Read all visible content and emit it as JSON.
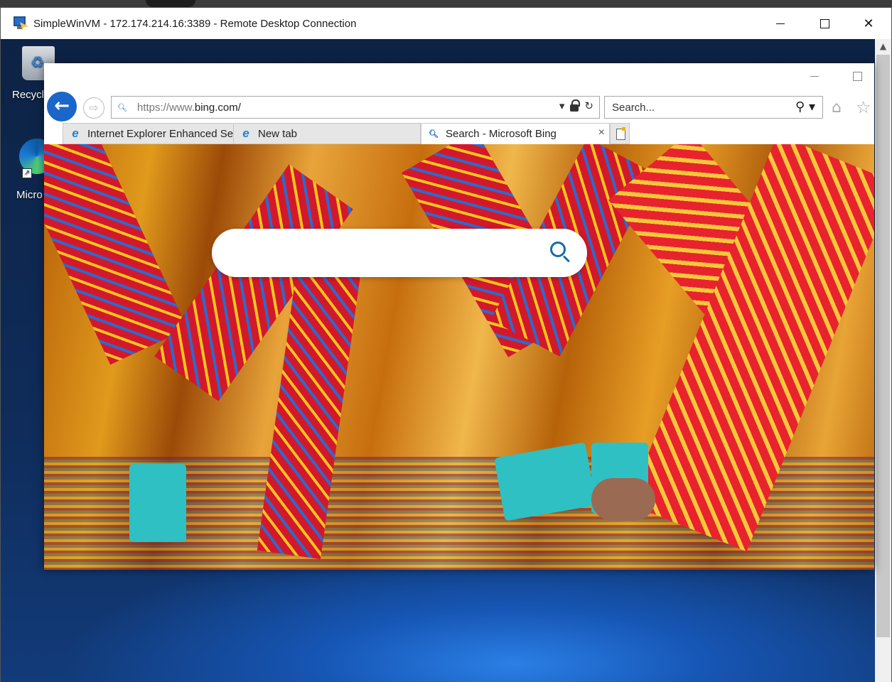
{
  "rdp": {
    "title": "SimpleWinVM - 172.174.214.16:3389 - Remote Desktop Connection",
    "min_glyph": "—",
    "max_glyph": "☐",
    "close_glyph": "✕"
  },
  "desktop": {
    "icons": [
      {
        "label": "Recycl",
        "icon": "recycle-bin-icon"
      },
      {
        "label": "Micro Edg",
        "icon": "edge-icon"
      }
    ]
  },
  "ie": {
    "address": {
      "url_prefix": "https://www.",
      "url_domain": "bing.com/"
    },
    "search_placeholder": "Search...",
    "tabs": [
      {
        "label": "Internet Explorer Enhanced Sec...",
        "icon": "ie-icon"
      },
      {
        "label": "New tab",
        "icon": "ie-icon"
      },
      {
        "label": "Search - Microsoft Bing",
        "icon": "search-icon",
        "active": true
      }
    ]
  },
  "bing": {
    "search_value": ""
  },
  "colors": {
    "accent": "#1b66c9",
    "bing_icon": "#1a6aa8",
    "desktop_bg": "#0f2c5a"
  }
}
